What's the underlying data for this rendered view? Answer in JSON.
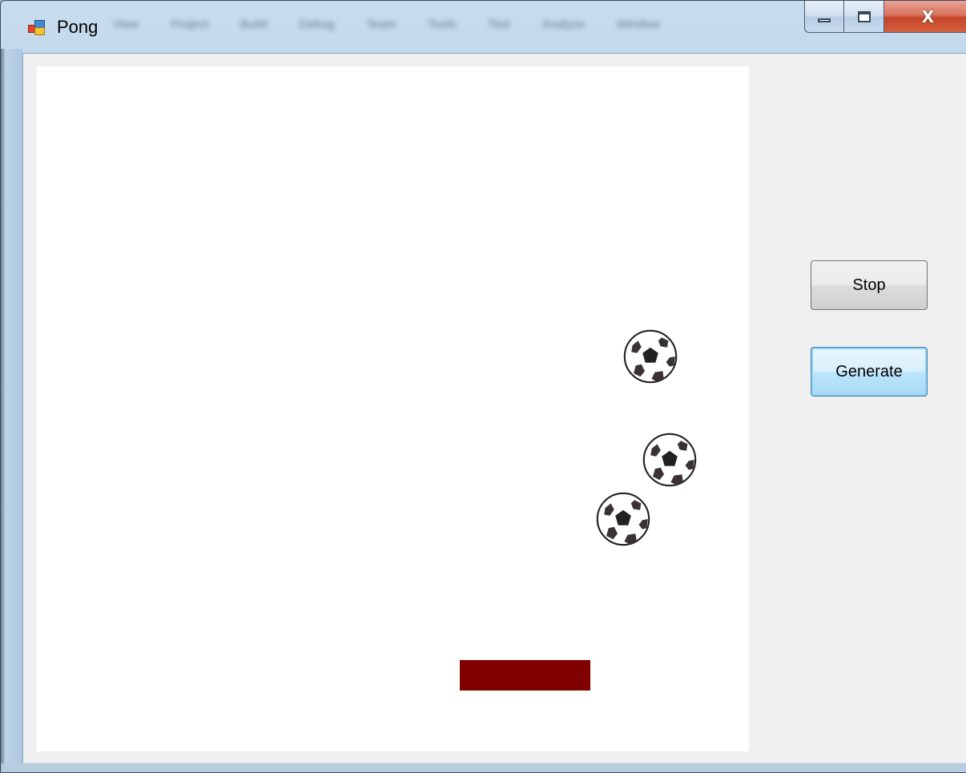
{
  "window": {
    "title": "Pong",
    "menu_blurred": [
      "View",
      "Project",
      "Build",
      "Debug",
      "Team",
      "Tools",
      "Test",
      "Analyze",
      "Window"
    ]
  },
  "caption_buttons": {
    "minimize_icon": "minimize-icon",
    "maximize_icon": "maximize-icon",
    "close_glyph": "X",
    "close_color": "#c5442a"
  },
  "playfield": {
    "background": "#ffffff",
    "paddle_color": "#800000",
    "balls": [
      {
        "icon": "soccer-ball-icon"
      },
      {
        "icon": "soccer-ball-icon"
      },
      {
        "icon": "soccer-ball-icon"
      }
    ]
  },
  "controls": {
    "stop_label": "Stop",
    "generate_label": "Generate"
  }
}
